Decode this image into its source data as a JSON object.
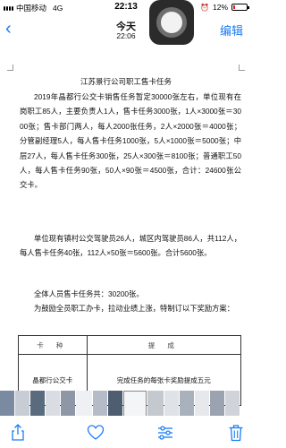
{
  "status_bar": {
    "carrier": "中国移动",
    "network": "4G",
    "time": "22:13",
    "battery_text": "12%",
    "battery_level": 0.12
  },
  "nav": {
    "back_icon": "chevron-left-icon",
    "title": "今天",
    "subtitle": "22:06",
    "edit_label": "编辑"
  },
  "document": {
    "title": "江苏景行公司职工售卡任务",
    "paragraphs": [
      "2019年晶都行公交卡销售任务暂定30000张左右，单位现有在岗职工85人，主要负责人1人，售卡任务3000张，1人×3000张＝3000张；售卡部门两人，每人2000张任务，2人×2000张＝4000张；分管副经理5人，每人售卡任务1000张，5人×1000张＝5000张；中层27人，每人售卡任务300张，25人×300张＝8100张；普通职工50人，每人售卡任务90张，50人×90张＝4500张，合计：24600张公交卡。",
      "单位现有镇村公交驾驶员26人，城区内驾驶员86人，共112人，每人售卡任务40张，112人×50张＝5600张。合计5600张。",
      "全体人员售卡任务共：30200张。",
      "为鼓励全员职工办卡，拉动业绩上涨，特制订以下奖励方案："
    ],
    "table": {
      "headers": [
        "卡 种",
        "提 成"
      ],
      "rows": [
        [
          "晶都行公交卡",
          "完成任务的每张卡奖励提成五元"
        ]
      ]
    }
  },
  "toolbar": {
    "icons": [
      "share-icon",
      "favorite-icon",
      "edit-icon",
      "delete-icon"
    ]
  },
  "colors": {
    "accent": "#1a7cf5",
    "battery_low": "#e02020"
  }
}
